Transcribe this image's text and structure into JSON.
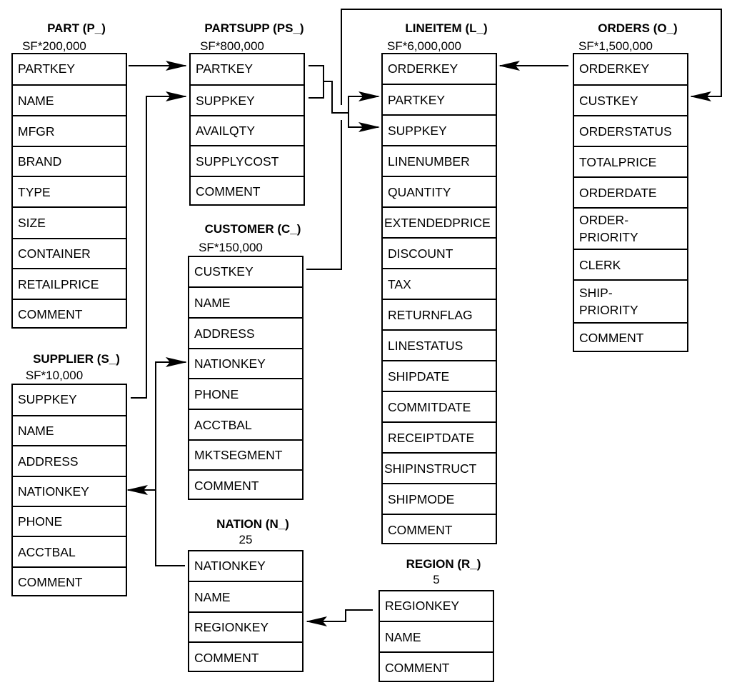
{
  "diagram": {
    "type": "schema-diagram",
    "tables": [
      {
        "id": "part",
        "title": "PART (P_)",
        "cardinality": "SF*200,000",
        "columns": [
          "PARTKEY",
          "NAME",
          "MFGR",
          "BRAND",
          "TYPE",
          "SIZE",
          "CONTAINER",
          "RETAILPRICE",
          "COMMENT"
        ]
      },
      {
        "id": "partsupp",
        "title": "PARTSUPP (PS_)",
        "cardinality": "SF*800,000",
        "columns": [
          "PARTKEY",
          "SUPPKEY",
          "AVAILQTY",
          "SUPPLYCOST",
          "COMMENT"
        ]
      },
      {
        "id": "lineitem",
        "title": "LINEITEM (L_)",
        "cardinality": "SF*6,000,000",
        "columns": [
          "ORDERKEY",
          "PARTKEY",
          "SUPPKEY",
          "LINENUMBER",
          "QUANTITY",
          "EXTENDEDPRICE",
          "DISCOUNT",
          "TAX",
          "RETURNFLAG",
          "LINESTATUS",
          "SHIPDATE",
          "COMMITDATE",
          "RECEIPTDATE",
          "SHIPINSTRUCT",
          "SHIPMODE",
          "COMMENT"
        ]
      },
      {
        "id": "orders",
        "title": "ORDERS (O_)",
        "cardinality": "SF*1,500,000",
        "columns": [
          "ORDERKEY",
          "CUSTKEY",
          "ORDERSTATUS",
          "TOTALPRICE",
          "ORDERDATE",
          "ORDER-\nPRIORITY",
          "CLERK",
          "SHIP-\nPRIORITY",
          "COMMENT"
        ]
      },
      {
        "id": "customer",
        "title": "CUSTOMER (C_)",
        "cardinality": "SF*150,000",
        "columns": [
          "CUSTKEY",
          "NAME",
          "ADDRESS",
          "NATIONKEY",
          "PHONE",
          "ACCTBAL",
          "MKTSEGMENT",
          "COMMENT"
        ]
      },
      {
        "id": "supplier",
        "title": "SUPPLIER (S_)",
        "cardinality": "SF*10,000",
        "columns": [
          "SUPPKEY",
          "NAME",
          "ADDRESS",
          "NATIONKEY",
          "PHONE",
          "ACCTBAL",
          "COMMENT"
        ]
      },
      {
        "id": "nation",
        "title": "NATION (N_)",
        "cardinality": "25",
        "columns": [
          "NATIONKEY",
          "NAME",
          "REGIONKEY",
          "COMMENT"
        ]
      },
      {
        "id": "region",
        "title": "REGION (R_)",
        "cardinality": "5",
        "columns": [
          "REGIONKEY",
          "NAME",
          "COMMENT"
        ]
      }
    ],
    "relationships": [
      {
        "from": "part.PARTKEY",
        "to": "partsupp.PARTKEY"
      },
      {
        "from": "supplier.SUPPKEY",
        "to": "partsupp.SUPPKEY"
      },
      {
        "from": "partsupp.PARTKEY",
        "to": "lineitem.PARTKEY"
      },
      {
        "from": "partsupp.SUPPKEY",
        "to": "lineitem.SUPPKEY"
      },
      {
        "from": "orders.ORDERKEY",
        "to": "lineitem.ORDERKEY"
      },
      {
        "from": "customer.CUSTKEY",
        "to": "orders.CUSTKEY"
      },
      {
        "from": "nation.NATIONKEY",
        "to": "customer.NATIONKEY"
      },
      {
        "from": "nation.NATIONKEY",
        "to": "supplier.NATIONKEY"
      },
      {
        "from": "region.REGIONKEY",
        "to": "nation.REGIONKEY"
      }
    ]
  }
}
